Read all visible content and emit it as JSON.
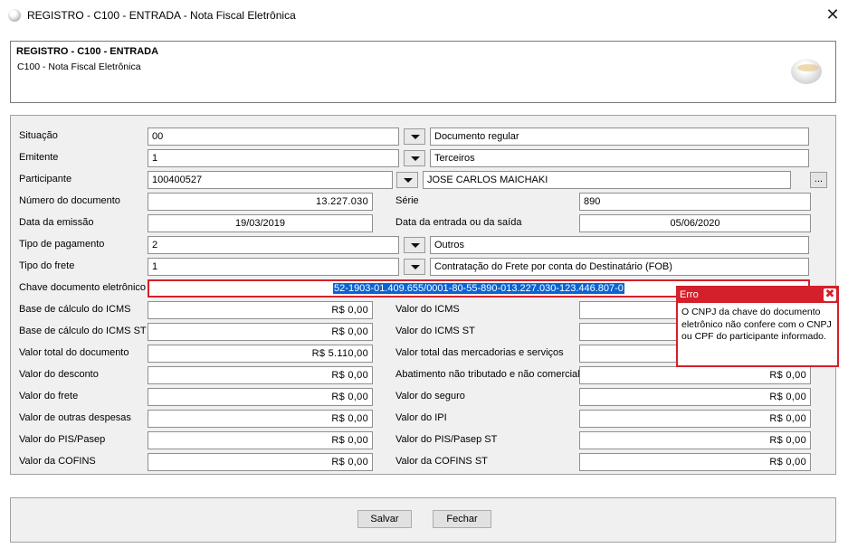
{
  "window": {
    "title": "REGISTRO - C100 - ENTRADA - Nota Fiscal Eletrônica",
    "close_symbol": "✕"
  },
  "header": {
    "title": "REGISTRO - C100 - ENTRADA",
    "subtitle": "C100 - Nota Fiscal Eletrônica",
    "logo_icon": "globe-logo-icon"
  },
  "form": {
    "situacao": {
      "label": "Situação",
      "code": "00",
      "description": "Documento regular"
    },
    "emitente": {
      "label": "Emitente",
      "code": "1",
      "description": "Terceiros"
    },
    "participante": {
      "label": "Participante",
      "code": "100400527",
      "description": "JOSE CARLOS MAICHAKI",
      "lookup_label": "..."
    },
    "numero_documento": {
      "label": "Número do documento",
      "value": "13.227.030"
    },
    "serie": {
      "label": "Série",
      "value": "890"
    },
    "data_emissao": {
      "label": "Data da emissão",
      "value": "19/03/2019"
    },
    "data_entrada_saida": {
      "label": "Data da entrada ou da saída",
      "value": "05/06/2020"
    },
    "tipo_pagamento": {
      "label": "Tipo de pagamento",
      "code": "2",
      "description": "Outros"
    },
    "tipo_frete": {
      "label": "Tipo do frete",
      "code": "1",
      "description": "Contratação do Frete por conta do Destinatário (FOB)"
    },
    "chave": {
      "label": "Chave documento eletrônico",
      "value": "52-1903-01.409.655/0001-80-55-890-013.227.030-123.446.807-0"
    },
    "left_values": [
      {
        "label": "Base de cálculo do ICMS",
        "value": "R$ 0,00"
      },
      {
        "label": "Base de cálculo do ICMS ST",
        "value": "R$ 0,00"
      },
      {
        "label": "Valor total do documento",
        "value": "R$ 5.110,00"
      },
      {
        "label": "Valor do desconto",
        "value": "R$ 0,00"
      },
      {
        "label": "Valor do frete",
        "value": "R$ 0,00"
      },
      {
        "label": "Valor de outras despesas",
        "value": "R$ 0,00"
      },
      {
        "label": "Valor do PIS/Pasep",
        "value": "R$ 0,00"
      },
      {
        "label": "Valor da COFINS",
        "value": "R$ 0,00"
      }
    ],
    "right_values": [
      {
        "label": "Valor do ICMS",
        "value": ""
      },
      {
        "label": "Valor do ICMS ST",
        "value": ""
      },
      {
        "label": "Valor total das mercadorias e serviços",
        "value": ""
      },
      {
        "label": "Abatimento não tributado e não comercial",
        "value": "R$ 0,00"
      },
      {
        "label": "Valor do seguro",
        "value": "R$ 0,00"
      },
      {
        "label": "Valor do IPI",
        "value": "R$ 0,00"
      },
      {
        "label": "Valor do PIS/Pasep ST",
        "value": "R$ 0,00"
      },
      {
        "label": "Valor da COFINS ST",
        "value": "R$ 0,00"
      }
    ]
  },
  "error": {
    "title": "Erro",
    "close_symbol": "✖",
    "message": "O CNPJ da chave do documento eletrônico não confere com o CNPJ ou CPF do participante informado."
  },
  "buttons": {
    "save": "Salvar",
    "close": "Fechar"
  },
  "colors": {
    "error": "#d4202a",
    "selection": "#0a64d3",
    "panel": "#f0f0f0"
  }
}
